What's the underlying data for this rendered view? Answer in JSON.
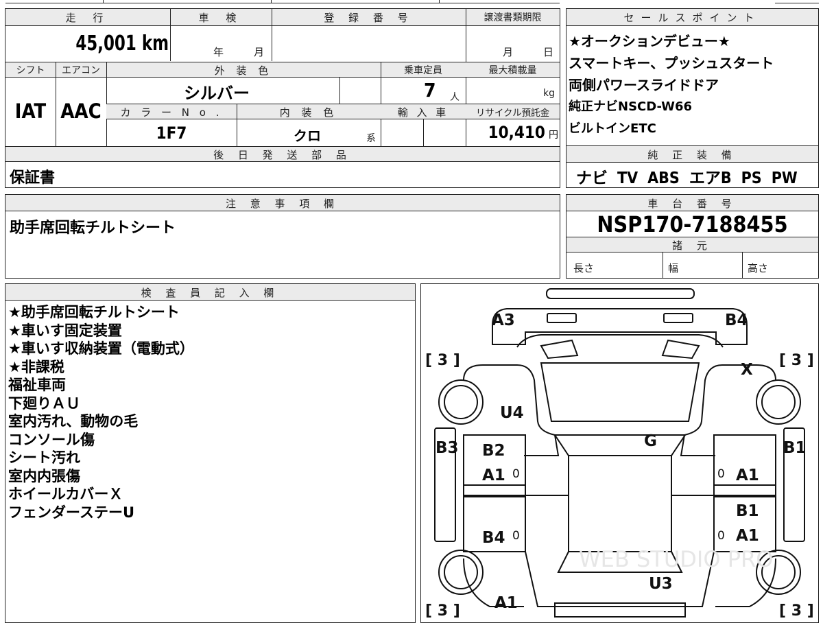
{
  "vehicle": {
    "mileage_label": "走 行",
    "mileage_value": "45,001",
    "mileage_unit": "km",
    "inspection_label": "車 検",
    "inspection_year_unit": "年",
    "inspection_month_unit": "月",
    "registration_label": "登 録 番 号",
    "transfer_deadline_label": "譲渡書類期限",
    "transfer_month_unit": "月",
    "transfer_day_unit": "日",
    "shift_label": "シフト",
    "shift_value": "IAT",
    "ac_label": "エアコン",
    "ac_value": "AAC",
    "exterior_color_label": "外 装 色",
    "exterior_color_value": "シルバー",
    "capacity_label": "乗車定員",
    "capacity_value": "7",
    "capacity_unit": "人",
    "max_load_label": "最大積載量",
    "max_load_unit": "kg",
    "color_no_label": "カ ラ ー N o .",
    "color_no_value": "1F7",
    "interior_color_label": "内 装 色",
    "interior_color_value": "クロ",
    "interior_color_suffix": "系",
    "import_label": "輸 入 車",
    "recycle_label": "リサイクル預託金",
    "recycle_value": "10,410",
    "recycle_unit": "円",
    "later_parts_label": "後 日 発 送 部 品",
    "later_parts_value": "保証書"
  },
  "notes": {
    "label": "注 意 事 項 欄",
    "value": "助手席回転チルトシート"
  },
  "sales_points": {
    "label": "セールスポイント",
    "items": [
      "★オークションデビュー★",
      "スマートキー、プッシュスタート",
      "両側パワースライドドア",
      "純正ナビNSCD-W66",
      "ビルトインETC"
    ]
  },
  "equipment": {
    "label": "純 正 装 備",
    "items": [
      "ナビ",
      "TV",
      "ABS",
      "エアB",
      "PS",
      "PW"
    ]
  },
  "chassis": {
    "label": "車 台 番 号",
    "value": "NSP170-7188455",
    "specs_label": "諸 元",
    "length_label": "長さ",
    "width_label": "幅",
    "height_label": "高さ"
  },
  "inspector": {
    "label": "検 査 員 記 入 欄",
    "lines": [
      "★助手席回転チルトシート",
      "★車いす固定装置",
      "★車いす収納装置（電動式）",
      "★非課税",
      "福祉車両",
      "下廻りＡＵ",
      "室内汚れ、動物の毛",
      "コンソール傷",
      "シート汚れ",
      "室内内張傷",
      "ホイールカバーＸ",
      "フェンダーステーU"
    ]
  },
  "diagram": {
    "watermark": "WEB STUDIO PRO",
    "tire_depth": "3",
    "marks": {
      "front_left": "A3",
      "front_right": "B4",
      "front_right_wheel": "X",
      "front_left_pillar": "U4",
      "center": "G",
      "left_rocker": "B3",
      "right_rocker": "B1",
      "left_front_door_1": "B2",
      "left_front_door_2": "A1",
      "left_rear_door": "B4",
      "right_front_door": "A1",
      "right_rear_door_1": "B1",
      "right_rear_door_2": "A1",
      "rear_center": "U3",
      "rear_left": "A1"
    },
    "zero": "0"
  }
}
